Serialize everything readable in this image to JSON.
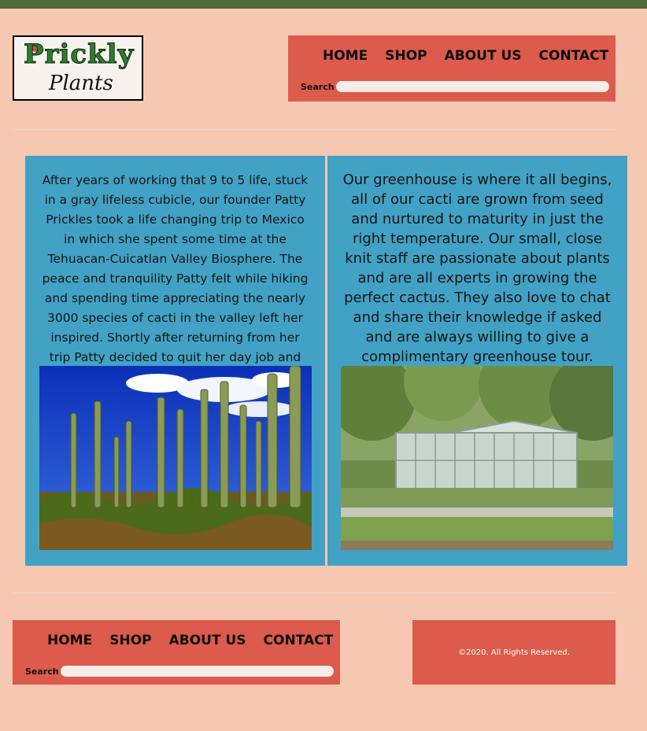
{
  "brand": {
    "logo_word1": "Prickly",
    "logo_word2": "Plants"
  },
  "nav": {
    "items": [
      "HOME",
      "SHOP",
      "ABOUT US",
      "CONTACT"
    ],
    "search_label": "Search"
  },
  "panels": [
    {
      "text": "After years of working that 9 to 5 life, stuck in a gray lifeless cubicle, our founder Patty Prickles took a life changing trip to Mexico in which she spent some time at the Tehuacan-Cuicatlan Valley Biosphere. The peace and tranquility Patty felt while hiking and spending time appreciating the nearly 3000 species of cacti in the valley left her inspired. Shortly after returning from her trip Patty decided to quit her day job and Prickly Plants was born.",
      "image_icon": "cactus-valley-photo"
    },
    {
      "text": "Our greenhouse is where it all begins, all of our cacti are grown from seed and nurtured to maturity in just the right temperature. Our small, close knit staff are passionate about plants and are all experts in growing the perfect cactus. They also love to chat and share their knowledge if asked and are always willing to give a complimentary greenhouse tour.",
      "image_icon": "greenhouse-photo"
    }
  ],
  "footer": {
    "copyright": "©2020. All Rights Reserved."
  },
  "colors": {
    "background": "#f6c8b2",
    "topbar": "#4d6b3b",
    "nav": "#dc5b4c",
    "panel": "#42a2c5"
  }
}
